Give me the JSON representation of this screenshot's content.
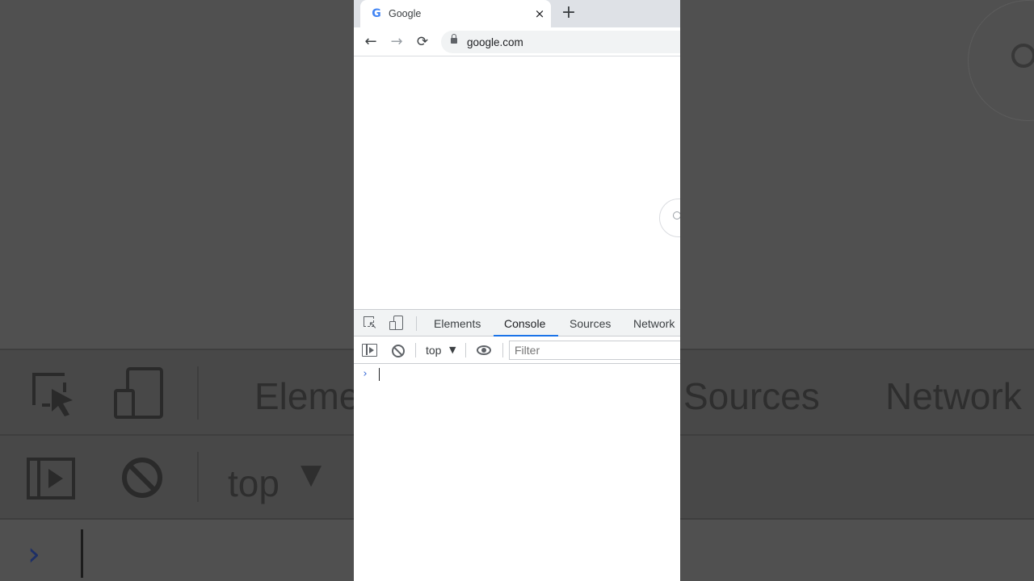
{
  "browser": {
    "tab": {
      "favicon": "G",
      "title": "Google",
      "close_glyph": "×"
    },
    "new_tab_glyph": "+",
    "nav": {
      "back_glyph": "←",
      "forward_glyph": "→",
      "reload_glyph": "⟳"
    },
    "address": {
      "url": "google.com",
      "icon": "lock-icon"
    }
  },
  "devtools": {
    "tabs": [
      {
        "label": "Elements",
        "active": false
      },
      {
        "label": "Console",
        "active": true
      },
      {
        "label": "Sources",
        "active": false
      },
      {
        "label": "Network",
        "active": false
      }
    ],
    "accent_color": "#1a73e8",
    "console": {
      "context": "top",
      "context_caret": "▼",
      "filter_placeholder": "Filter",
      "prompt": "›"
    }
  },
  "background": {
    "tabs": [
      "Eleme",
      "Sources",
      "Network"
    ],
    "context": "top",
    "context_caret": "▼",
    "prompt": "›"
  }
}
